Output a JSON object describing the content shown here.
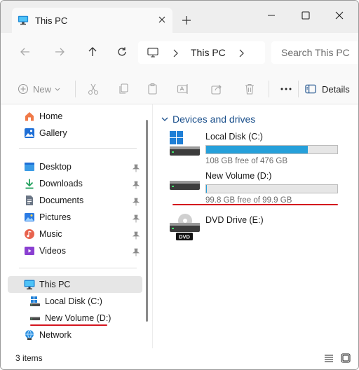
{
  "tab": {
    "title": "This PC"
  },
  "address": {
    "location": "This PC"
  },
  "search": {
    "placeholder": "Search This PC"
  },
  "toolbar": {
    "new_label": "New",
    "details_label": "Details"
  },
  "sidebar": {
    "items": [
      {
        "label": "Home",
        "icon": "home-icon"
      },
      {
        "label": "Gallery",
        "icon": "gallery-icon"
      },
      {
        "label": "Desktop",
        "icon": "desktop-icon",
        "pinned": true
      },
      {
        "label": "Downloads",
        "icon": "downloads-icon",
        "pinned": true
      },
      {
        "label": "Documents",
        "icon": "documents-icon",
        "pinned": true
      },
      {
        "label": "Pictures",
        "icon": "pictures-icon",
        "pinned": true
      },
      {
        "label": "Music",
        "icon": "music-icon",
        "pinned": true
      },
      {
        "label": "Videos",
        "icon": "videos-icon",
        "pinned": true
      },
      {
        "label": "This PC",
        "icon": "this-pc-icon",
        "selected": true
      },
      {
        "label": "Local Disk (C:)",
        "icon": "drive-icon"
      },
      {
        "label": "New Volume (D:)",
        "icon": "drive-icon"
      },
      {
        "label": "Network",
        "icon": "network-icon"
      }
    ]
  },
  "main": {
    "group_title": "Devices and drives",
    "drives": [
      {
        "name": "Local Disk (C:)",
        "free_text": "108 GB free of 476 GB",
        "used_fraction": 0.773
      },
      {
        "name": "New Volume (D:)",
        "free_text": "99.8 GB free of 99.9 GB",
        "used_fraction": 0.001
      },
      {
        "name": "DVD Drive (E:)",
        "badge": "DVD"
      }
    ]
  },
  "status": {
    "item_count": "3 items"
  },
  "colors": {
    "accent": "#26a0da",
    "highlight_underline": "#d4141e",
    "group_title": "#1a4f8b"
  }
}
